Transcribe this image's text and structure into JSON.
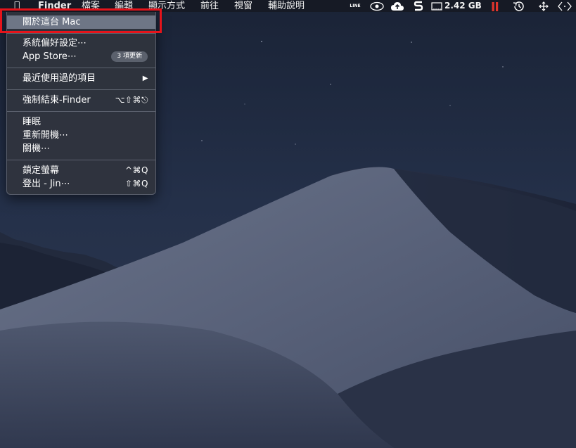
{
  "menubar": {
    "app_name": "Finder",
    "menus": [
      "檔案",
      "編輯",
      "顯示方式",
      "前往",
      "視窗",
      "輔助說明"
    ],
    "status": {
      "line_label": "LINE",
      "memory": "2.42 GB"
    }
  },
  "apple_menu": {
    "items": [
      {
        "label": "關於這台 Mac"
      },
      {
        "label": "系統偏好設定⋯"
      },
      {
        "label": "App Store⋯",
        "badge": "3 項更新"
      },
      {
        "label": "最近使用過的項目",
        "submenu_arrow": "▶"
      },
      {
        "label": "強制結束-Finder",
        "shortcut": "⌥⇧⌘⎋"
      },
      {
        "label": "睡眠"
      },
      {
        "label": "重新開機⋯"
      },
      {
        "label": "關機⋯"
      },
      {
        "label": "鎖定螢幕",
        "shortcut": "^⌘Q"
      },
      {
        "label": "登出 - Jin⋯",
        "shortcut": "⇧⌘Q"
      }
    ]
  },
  "colors": {
    "highlight_frame": "#e5141b",
    "menu_background": "#30343e",
    "sky": "#1f2a3f",
    "dune": "#5b6478"
  }
}
